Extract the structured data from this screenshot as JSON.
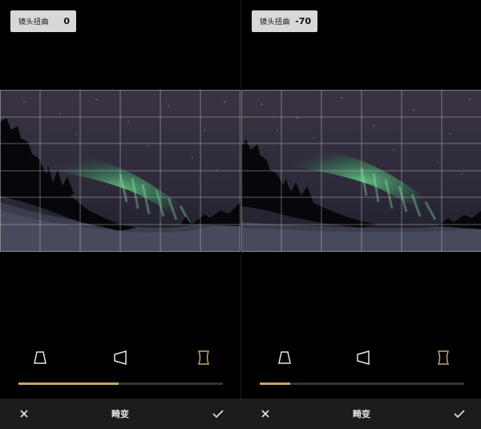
{
  "accent_color": "#c7a56a",
  "panels": [
    {
      "badge": {
        "label": "镜头扭曲",
        "value": "0"
      },
      "slider": {
        "fill_fraction": 0.49
      },
      "bottom": {
        "title": "畸变",
        "cancel_icon": "close-icon",
        "confirm_icon": "checkmark-icon"
      },
      "tools": [
        {
          "name": "trapezoid-vertical-icon",
          "selected": false
        },
        {
          "name": "trapezoid-horizontal-icon",
          "selected": false
        },
        {
          "name": "lens-distortion-icon",
          "selected": true
        }
      ]
    },
    {
      "badge": {
        "label": "镜头扭曲",
        "value": "-70"
      },
      "slider": {
        "fill_fraction": 0.15
      },
      "bottom": {
        "title": "畸变",
        "cancel_icon": "close-icon",
        "confirm_icon": "checkmark-icon"
      },
      "tools": [
        {
          "name": "trapezoid-vertical-icon",
          "selected": false
        },
        {
          "name": "trapezoid-horizontal-icon",
          "selected": false
        },
        {
          "name": "lens-distortion-icon",
          "selected": true
        }
      ]
    }
  ]
}
